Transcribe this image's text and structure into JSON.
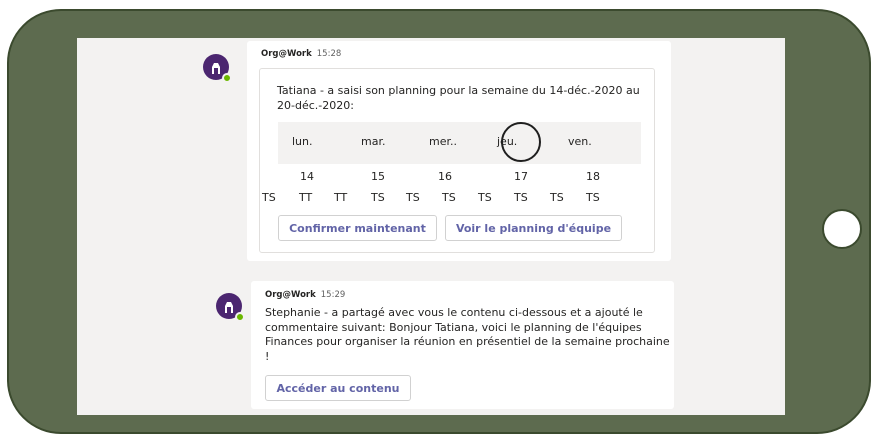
{
  "colors": {
    "frame": "#5d6b4f",
    "avatar": "#4b2670",
    "accent": "#6264a7",
    "presence": "#6bb700"
  },
  "icons": {
    "bot_avatar": "org-work-bot-icon",
    "presence": "presence-available-icon"
  },
  "messages": [
    {
      "sender": "Org@Work",
      "time": "15:28",
      "text": "Tatiana - a saisi son planning pour la semaine du 14-déc.-2020 au 20-déc.-2020:",
      "schedule": {
        "days": [
          "lun.",
          "mar.",
          "mer..",
          "jeu.",
          "ven."
        ],
        "dates": [
          "14",
          "15",
          "16",
          "17",
          "18"
        ],
        "shifts": [
          "TS",
          "TT",
          "TT",
          "TS",
          "TS",
          "TS",
          "TS",
          "TS",
          "TS",
          "TS"
        ]
      },
      "actions": {
        "confirm": "Confirmer maintenant",
        "team_planning": "Voir le planning d'équipe"
      }
    },
    {
      "sender": "Org@Work",
      "time": "15:29",
      "text": "Stephanie - a partagé avec vous le contenu ci-dessous et a ajouté le commentaire suivant: Bonjour Tatiana, voici le planning de l'équipes Finances pour organiser la réunion en présentiel de la semaine prochaine !",
      "actions": {
        "access": "Accéder au contenu"
      }
    }
  ]
}
